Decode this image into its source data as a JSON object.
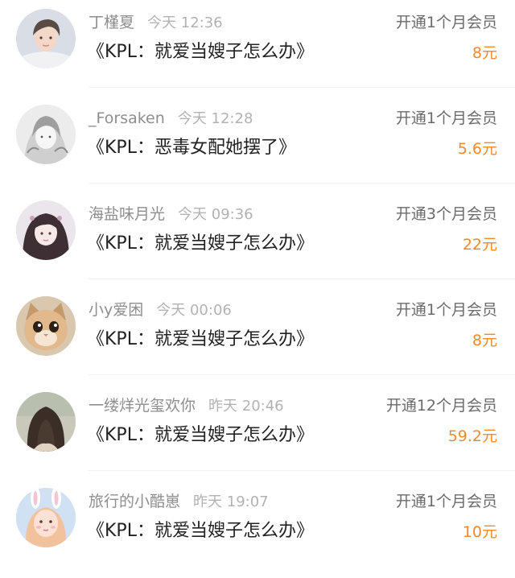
{
  "orders": [
    {
      "user_name": "丁槿夏",
      "time": "今天 12:36",
      "book_title": "《KPL：就爱当嫂子怎么办》",
      "action": "开通1个月会员",
      "amount": "8元",
      "avatar_icon": "avatar-young-man-icon"
    },
    {
      "user_name": "_Forsaken",
      "time": "今天 12:28",
      "book_title": "《KPL：恶毒女配她摆了》",
      "action": "开通1个月会员",
      "amount": "5.6元",
      "avatar_icon": "avatar-sketch-girl-icon"
    },
    {
      "user_name": "海盐味月光",
      "time": "今天 09:36",
      "book_title": "《KPL：就爱当嫂子怎么办》",
      "action": "开通3个月会员",
      "amount": "22元",
      "avatar_icon": "avatar-drawn-girl-icon"
    },
    {
      "user_name": "小y爱困",
      "time": "今天 00:06",
      "book_title": "《KPL：就爱当嫂子怎么办》",
      "action": "开通1个月会员",
      "amount": "8元",
      "avatar_icon": "avatar-cat-icon"
    },
    {
      "user_name": "一缕烊光玺欢你",
      "time": "昨天 20:46",
      "book_title": "《KPL：就爱当嫂子怎么办》",
      "action": "开通12个月会员",
      "amount": "59.2元",
      "avatar_icon": "avatar-long-hair-girl-icon"
    },
    {
      "user_name": "旅行的小酷崽",
      "time": "昨天 19:07",
      "book_title": "《KPL：就爱当嫂子怎么办》",
      "action": "开通1个月会员",
      "amount": "10元",
      "avatar_icon": "avatar-bunny-girl-icon"
    }
  ],
  "colors": {
    "amount": "#f08a2a",
    "user_name": "#8e8e8e",
    "time": "#b2b2b2",
    "title": "#222222"
  }
}
